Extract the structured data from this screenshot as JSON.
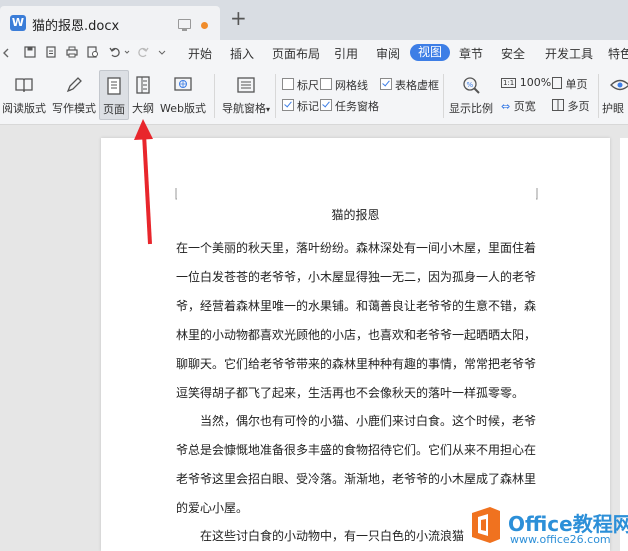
{
  "window": {
    "tab_title": "猫的报恩.docx"
  },
  "menu": [
    "开始",
    "插入",
    "页面布局",
    "引用",
    "审阅",
    "视图",
    "章节",
    "安全",
    "开发工具",
    "特色"
  ],
  "ribbon": {
    "read_mode": "阅读版式",
    "write_mode": "写作模式",
    "page": "页面",
    "outline": "大纲",
    "web": "Web版式",
    "nav_pane": "导航窗格",
    "ruler": "标尺",
    "gridlines": "网格线",
    "table_gridlines": "表格虚框",
    "markers": "标记",
    "task_pane": "任务窗格",
    "zoom_ratio": "显示比例",
    "zoom_100": "100%",
    "page_width": "页宽",
    "single_page": "单页",
    "multi_page": "多页",
    "eye_protect": "护眼"
  },
  "checkboxes": {
    "ruler": false,
    "gridlines": false,
    "table_gridlines": true,
    "markers": true,
    "task_pane": true
  },
  "document": {
    "title": "猫的报恩",
    "paragraphs": [
      "在一个美丽的秋天里，落叶纷纷。森林深处有一间小木屋，里面住着一位白发苍苍的老爷爷，小木屋显得独一无二，因为孤身一人的老爷爷，经营着森林里唯一的水果铺。和蔼善良让老爷爷的生意不错，森林里的小动物都喜欢光顾他的小店，也喜欢和老爷爷一起晒晒太阳，聊聊天。它们给老爷爷带来的森林里种种有趣的事情，常常把老爷爷逗笑得胡子都飞了起来，生活再也不会像秋天的落叶一样孤零零。",
      "当然，偶尔也有可怜的小猫、小鹿们来讨白食。这个时候，老爷爷总是会慷慨地准备很多丰盛的食物招待它们。它们从来不用担心在老爷爷这里会招白眼、受冷落。渐渐地，老爷爷的小木屋成了森林里的爱心小屋。",
      "在这些讨白食的小动物中，有一只白色的小流浪猫"
    ]
  },
  "watermark": {
    "title": "Office教程网",
    "url": "www.office26.com"
  },
  "colors": {
    "accent": "#3d7ee6",
    "arrow": "#e8262c",
    "watermark_orange": "#f0721f",
    "watermark_blue": "#2c8fd8"
  }
}
